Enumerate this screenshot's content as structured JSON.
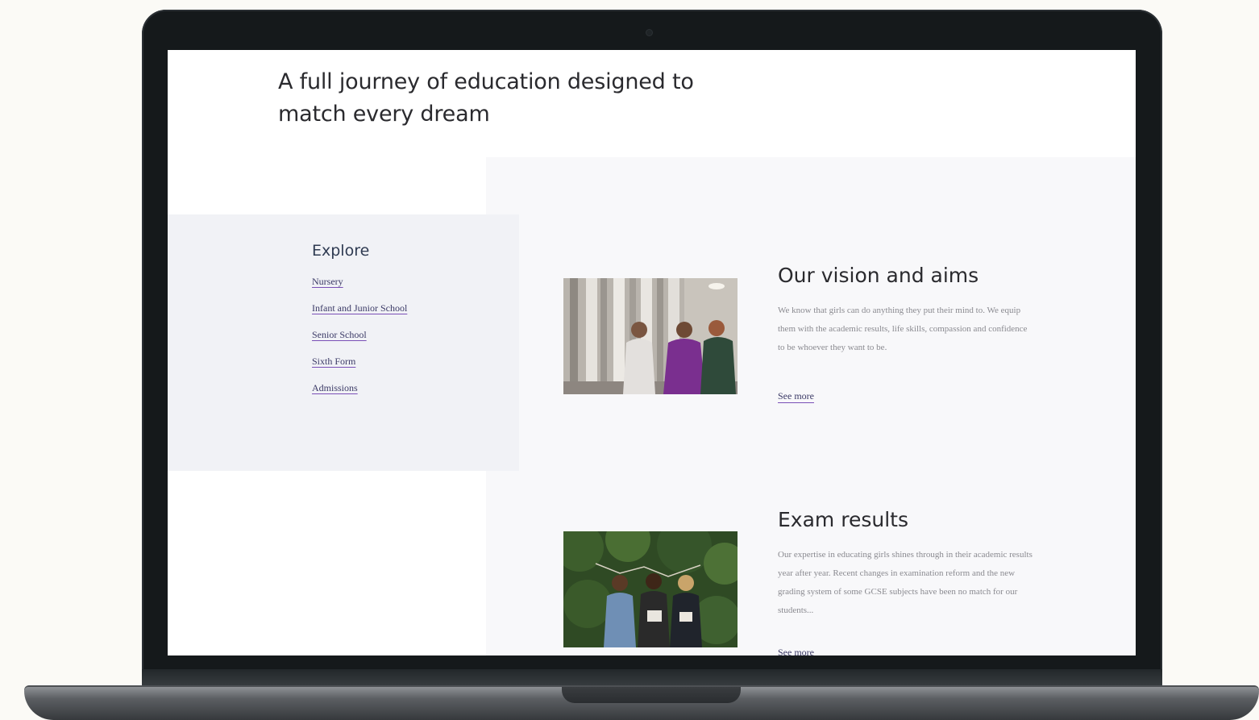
{
  "page": {
    "heading": "A full journey of education designed to match every dream"
  },
  "explore": {
    "title": "Explore",
    "links": [
      {
        "label": "Nursery"
      },
      {
        "label": "Infant and Junior School"
      },
      {
        "label": "Senior School"
      },
      {
        "label": "Sixth Form"
      },
      {
        "label": "Admissions"
      }
    ]
  },
  "cards": [
    {
      "title": "Our vision and aims",
      "text": "We know that girls can do anything they put their mind to. We equip them with the academic results, life skills, compassion and confidence to be whoever they want to be.",
      "link": "See more"
    },
    {
      "title": "Exam results",
      "text": "Our expertise in educating girls shines through in their academic results year after year. Recent changes in examination reform and the new grading system of some GCSE subjects have been no match for our students...",
      "link": "See more"
    }
  ],
  "colors": {
    "heading": "#2a2a2e",
    "explore_title": "#2f3b52",
    "link": "#3b3a66",
    "link_underline": "#7a4fb6",
    "panel_bg": "#f8f8fa",
    "explore_bg": "#f1f2f6"
  }
}
